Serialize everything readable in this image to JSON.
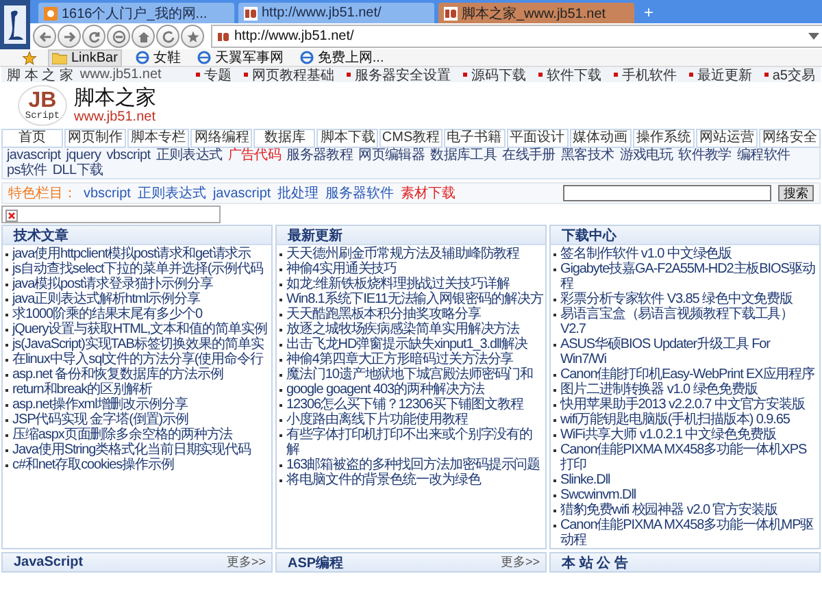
{
  "browser": {
    "tabs": [
      {
        "title": "1616个人门户_我的网...",
        "kind": "portal",
        "selected": false
      },
      {
        "title": "http://www.jb51.net/",
        "kind": "site",
        "selected": false
      },
      {
        "title": "脚本之家_www.jb51.net",
        "kind": "site",
        "selected": true
      }
    ],
    "new_tab": "+",
    "address": "http://www.jb51.net/",
    "bookmarks": [
      {
        "label": "LinkBar",
        "kind": "folder"
      },
      {
        "label": "女鞋",
        "kind": "page"
      },
      {
        "label": "天翼军事网",
        "kind": "page"
      },
      {
        "label": "免费上网...",
        "kind": "page"
      }
    ]
  },
  "page": {
    "top_bar": {
      "site": "脚 本 之 家",
      "url": "www.jb51.net",
      "links": [
        "专题",
        "网页教程基础",
        "服务器安全设置",
        "源码下载",
        "软件下载",
        "手机软件",
        "最近更新",
        "a5交易"
      ]
    },
    "logo": {
      "mark": "JB",
      "tagline": "Script",
      "name": "脚本之家",
      "url": "www.jb51.net"
    },
    "nav": [
      "首页",
      "网页制作",
      "脚本专栏",
      "网络编程",
      "数据库",
      "脚本下载",
      "CMS教程",
      "电子书籍",
      "平面设计",
      "媒体动画",
      "操作系统",
      "网站运营",
      "网络安全"
    ],
    "subnav": [
      {
        "label": "javascript",
        "highlight": false
      },
      {
        "label": "jquery",
        "highlight": false
      },
      {
        "label": "vbscript",
        "highlight": false
      },
      {
        "label": "正则表达式",
        "highlight": false
      },
      {
        "label": "广告代码",
        "highlight": true
      },
      {
        "label": "服务器教程",
        "highlight": false
      },
      {
        "label": "网页编辑器",
        "highlight": false
      },
      {
        "label": "数据库工具",
        "highlight": false
      },
      {
        "label": "在线手册",
        "highlight": false
      },
      {
        "label": "黑客技术",
        "highlight": false
      },
      {
        "label": "游戏电玩",
        "highlight": false
      },
      {
        "label": "软件教学",
        "highlight": false
      },
      {
        "label": "编程软件",
        "highlight": false
      },
      {
        "label": "ps软件",
        "highlight": false
      },
      {
        "label": "DLL下载",
        "highlight": false
      }
    ],
    "featured": {
      "label": "特色栏目：",
      "links": [
        {
          "label": "vbscript",
          "highlight": false
        },
        {
          "label": "正则表达式",
          "highlight": false
        },
        {
          "label": "javascript",
          "highlight": false
        },
        {
          "label": "批处理",
          "highlight": false
        },
        {
          "label": "服务器软件",
          "highlight": false
        },
        {
          "label": "素材下载",
          "highlight": true
        }
      ]
    },
    "search": {
      "button": "搜索"
    },
    "columns": [
      {
        "title": "技术文章",
        "items": [
          "java使用httpclient模拟post请求和get请求示",
          "js自动查找select下拉的菜单并选择(示例代码",
          "java模拟post请求登录猫扑示例分享",
          "java正则表达式解析html示例分享",
          "求1000阶乘的结果末尾有多少个0",
          "jQuery设置与获取HTML,文本和值的简单实例",
          "js(JavaScript)实现TAB标签切换效果的简单实",
          "在linux中导入sql文件的方法分享(使用命令行",
          "asp.net 备份和恢复数据库的方法示例",
          "return和break的区别解析",
          "asp.net操作xml增删改示例分享",
          "JSP代码实现 金字塔(倒置)示例",
          "压缩aspx页面删除多余空格的两种方法",
          "Java使用String类格式化当前日期实现代码",
          "c#和net存取cookies操作示例"
        ]
      },
      {
        "title": "最新更新",
        "items": [
          "天天德州刷金币常规方法及辅助峰防教程",
          "神偷4实用通关技巧",
          "如龙:维新铁板烧料理挑战过关技巧详解",
          "Win8.1系统下IE11无法输入网银密码的解决方",
          "天天酷跑黑板本积分抽奖攻略分享",
          "放逐之城牧场疾病感染简单实用解决方法",
          "出击飞龙HD弹窗提示缺失xinput1_3.dll解决",
          "神偷4第四章大正方形暗码过关方法分享",
          "魔法门10遗产地狱地下城宫殿法师密码门和",
          "google goagent 403的两种解决方法",
          "12306怎么买下铺？12306买下铺图文教程",
          "小度路由离线下片功能使用教程",
          "有些字体打印机打印不出来或个别字没有的解",
          "163邮箱被盗的多种找回方法加密码提示问题",
          "将电脑文件的背景色统一改为绿色"
        ]
      },
      {
        "title": "下载中心",
        "items": [
          "签名制作软件 v1.0 中文绿色版",
          "Gigabyte技嘉GA-F2A55M-HD2主板BIOS驱动程",
          "彩票分析专家软件 V3.85 绿色中文免费版",
          "易语言宝盒（易语言视频教程下载工具）V2.7",
          "ASUS华硕BIOS Updater升级工具 For Win7/Wi",
          "Canon佳能打印机Easy-WebPrint EX应用程序",
          "图片二进制转换器 v1.0 绿色免费版",
          "快用苹果助手2013 v2.2.0.7 中文官方安装版",
          "wifi万能钥匙电脑版(手机扫描版本) 0.9.65",
          "WiFi共享大师 v1.0.2.1 中文绿色免费版",
          "Canon佳能PIXMA MX458多功能一体机XPS打印",
          "Slinke.Dll",
          "Swcwinvm.Dll",
          "猎豹免费wifi 校园神器 v2.0 官方安装版",
          "Canon佳能PIXMA MX458多功能一体机MP驱动程"
        ]
      }
    ],
    "bottom_panels": [
      {
        "title": "JavaScript",
        "more": "更多>>"
      },
      {
        "title": "ASP编程",
        "more": "更多>>"
      },
      {
        "title": "本 站 公 告"
      }
    ]
  }
}
